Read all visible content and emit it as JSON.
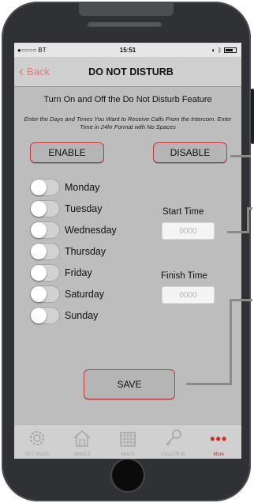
{
  "status": {
    "carrier": "●○○○○ BT",
    "time": "15:51"
  },
  "nav": {
    "back_label": "Back",
    "title": "DO NOT DISTURB"
  },
  "heading": "Turn On and Off the Do Not Disturb Feature",
  "instructions": "Enter the Days and Times You Want to Receive Calls From the Intercom.   Enter Time in 24hr Format with No Spaces",
  "buttons": {
    "enable": "ENABLE",
    "disable": "DISABLE",
    "save": "SAVE"
  },
  "days": [
    {
      "label": "Monday",
      "on": false
    },
    {
      "label": "Tuesday",
      "on": false
    },
    {
      "label": "Wednesday",
      "on": false
    },
    {
      "label": "Thursday",
      "on": false
    },
    {
      "label": "Friday",
      "on": false
    },
    {
      "label": "Saturday",
      "on": false
    },
    {
      "label": "Sunday",
      "on": false
    }
  ],
  "start_time": {
    "label": "Start Time",
    "placeholder": "0000"
  },
  "finish_time": {
    "label": "Finish Time",
    "placeholder": "0000"
  },
  "tabs": [
    {
      "label": "SETTINGS",
      "icon": "gear-icon"
    },
    {
      "label": "SINGLE",
      "icon": "house-icon"
    },
    {
      "label": "MULTI",
      "icon": "building-icon"
    },
    {
      "label": "CALLER ID",
      "icon": "key-icon"
    },
    {
      "label": "More",
      "icon": "more-dots-icon"
    }
  ],
  "colors": {
    "accent_red": "#cc2a2a",
    "back_pink": "#e07a7e",
    "screen_bg": "#bdbdbd"
  }
}
